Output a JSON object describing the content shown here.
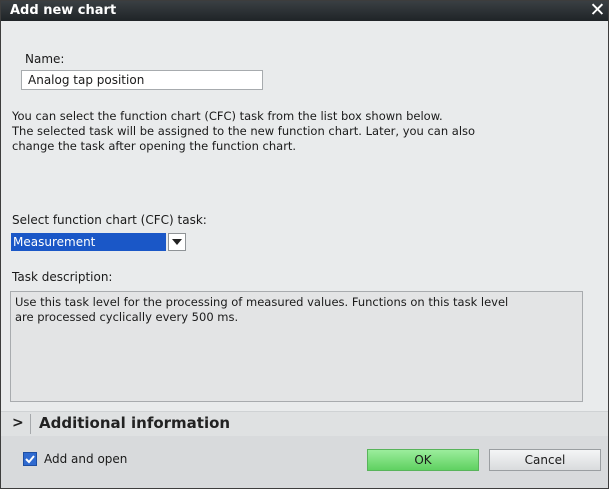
{
  "dialog": {
    "title": "Add new chart",
    "close_glyph": "✕"
  },
  "name": {
    "label": "Name:",
    "value": "Analog tap position"
  },
  "info_lines": [
    "You can select the function chart (CFC) task from the list box shown below.",
    "The selected task will be assigned to the new function chart. Later, you can also",
    "change the task after opening the function chart."
  ],
  "task": {
    "label": "Select function chart (CFC) task:",
    "selected": "Measurement"
  },
  "description": {
    "label": "Task description:",
    "lines": [
      "Use this task level for the processing of measured values. Functions on this task level",
      "are processed cyclically every 500 ms."
    ]
  },
  "additional": {
    "chevron": ">",
    "label": "Additional information"
  },
  "footer": {
    "checkbox_label": "Add and open",
    "checked": true,
    "ok_label": "OK",
    "cancel_label": "Cancel"
  },
  "colors": {
    "accent": "#1a57c7",
    "ok_button": "#6fdc70",
    "titlebar": "#2a2f33"
  }
}
